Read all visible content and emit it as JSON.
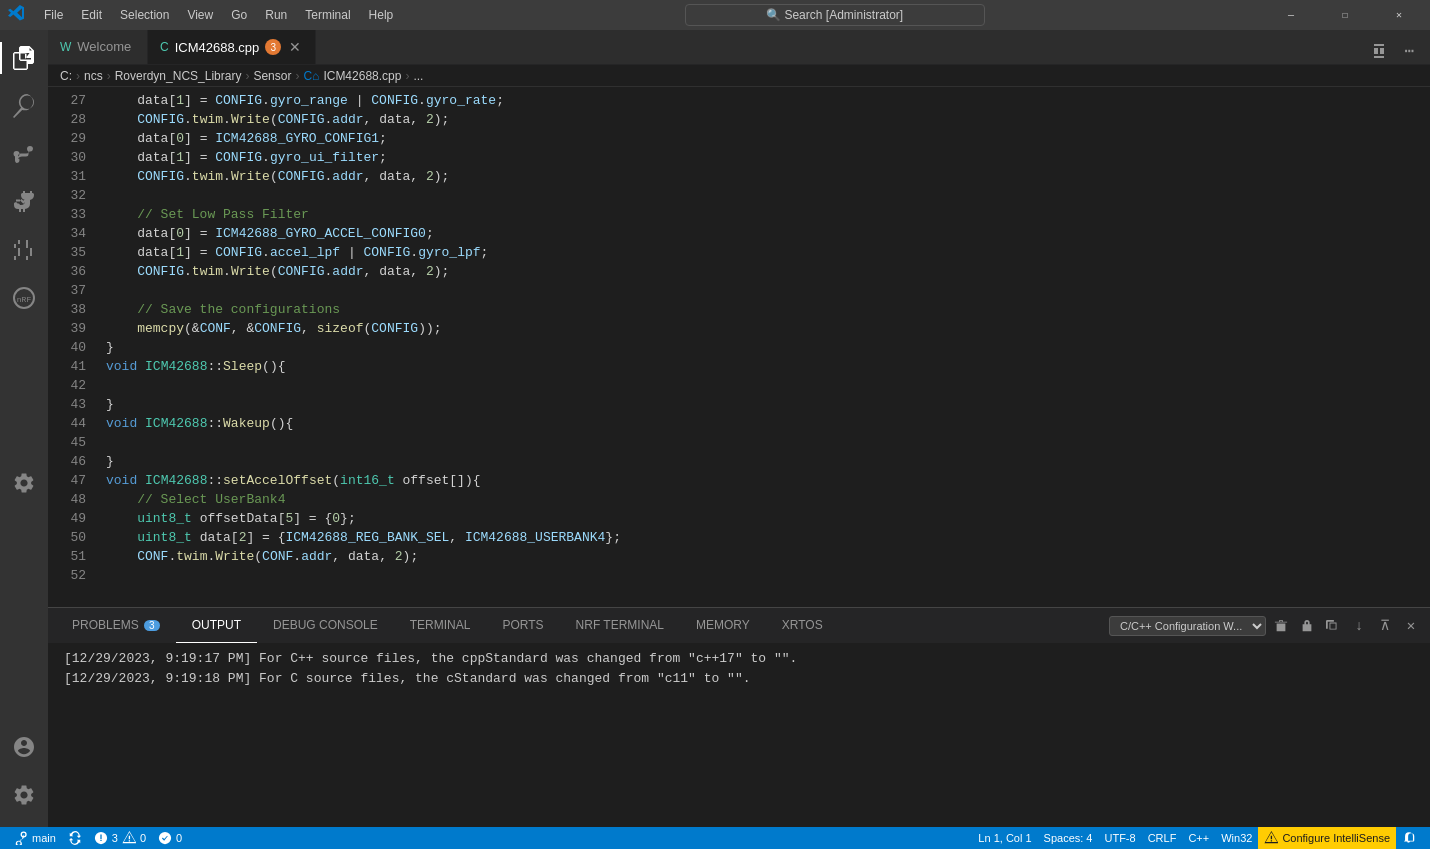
{
  "titlebar": {
    "menus": [
      "File",
      "Edit",
      "Selection",
      "View",
      "Go",
      "Run",
      "Terminal",
      "Help"
    ],
    "search_placeholder": "Search [Administrator]",
    "icon": "vscode"
  },
  "tabs": [
    {
      "label": "Welcome",
      "active": false,
      "closable": false,
      "icon": "W"
    },
    {
      "label": "ICM42688.cpp",
      "active": true,
      "closable": true,
      "modified": true,
      "count": 3,
      "icon": "C"
    }
  ],
  "breadcrumb": {
    "items": [
      "C:",
      "ncs",
      "Roverdyn_NCS_Library",
      "Sensor",
      "ICM42688.cpp",
      "..."
    ]
  },
  "code": {
    "lines": [
      {
        "num": 27,
        "content": "    data[1] = CONFIG.gyro_range | CONFIG.gyro_rate;"
      },
      {
        "num": 28,
        "content": "    CONFIG.twim.Write(CONFIG.addr, data, 2);"
      },
      {
        "num": 29,
        "content": "    data[0] = ICM42688_GYRO_CONFIG1;"
      },
      {
        "num": 30,
        "content": "    data[1] = CONFIG.gyro_ui_filter;"
      },
      {
        "num": 31,
        "content": "    CONFIG.twim.Write(CONFIG.addr, data, 2);"
      },
      {
        "num": 32,
        "content": ""
      },
      {
        "num": 33,
        "content": "    // Set Low Pass Filter"
      },
      {
        "num": 34,
        "content": "    data[0] = ICM42688_GYRO_ACCEL_CONFIG0;"
      },
      {
        "num": 35,
        "content": "    data[1] = CONFIG.accel_lpf | CONFIG.gyro_lpf;"
      },
      {
        "num": 36,
        "content": "    CONFIG.twim.Write(CONFIG.addr, data, 2);"
      },
      {
        "num": 37,
        "content": ""
      },
      {
        "num": 38,
        "content": "    // Save the configurations"
      },
      {
        "num": 39,
        "content": "    memcpy(&CONF, &CONFIG, sizeof(CONFIG));"
      },
      {
        "num": 40,
        "content": "}"
      },
      {
        "num": 41,
        "content": "void ICM42688::Sleep(){"
      },
      {
        "num": 42,
        "content": ""
      },
      {
        "num": 43,
        "content": "}"
      },
      {
        "num": 44,
        "content": "void ICM42688::Wakeup(){"
      },
      {
        "num": 45,
        "content": ""
      },
      {
        "num": 46,
        "content": "}"
      },
      {
        "num": 47,
        "content": "void ICM42688::setAccelOffset(int16_t offset[]){"
      },
      {
        "num": 48,
        "content": "    // Select UserBank4"
      },
      {
        "num": 49,
        "content": "    uint8_t offsetData[5] = {0};"
      },
      {
        "num": 50,
        "content": "    uint8_t data[2] = {ICM42688_REG_BANK_SEL, ICM42688_USERBANK4};"
      },
      {
        "num": 51,
        "content": "    CONF.twim.Write(CONF.addr, data, 2);"
      },
      {
        "num": 52,
        "content": ""
      }
    ]
  },
  "panel": {
    "tabs": [
      {
        "label": "PROBLEMS",
        "badge": "3",
        "active": false
      },
      {
        "label": "OUTPUT",
        "active": true
      },
      {
        "label": "DEBUG CONSOLE",
        "active": false
      },
      {
        "label": "TERMINAL",
        "active": false
      },
      {
        "label": "PORTS",
        "active": false
      },
      {
        "label": "NRF TERMINAL",
        "active": false
      },
      {
        "label": "MEMORY",
        "active": false
      },
      {
        "label": "XRTOS",
        "active": false
      }
    ],
    "output_selector": "C/C++ Configuration W...",
    "log_lines": [
      "[12/29/2023, 9:19:17 PM] For C++ source files, the cppStandard was changed from \"c++17\" to \"\".",
      "[12/29/2023, 9:19:18 PM] For C source files, the cStandard was changed from \"c11\" to \"\"."
    ]
  },
  "statusbar": {
    "branch": "main",
    "sync": true,
    "errors": "3",
    "warnings": "0",
    "no_problems": "0",
    "ln": "Ln 1, Col 1",
    "spaces": "Spaces: 4",
    "encoding": "UTF-8",
    "line_ending": "CRLF",
    "language": "C++",
    "platform": "Win32",
    "configure": "Configure IntelliSense"
  }
}
